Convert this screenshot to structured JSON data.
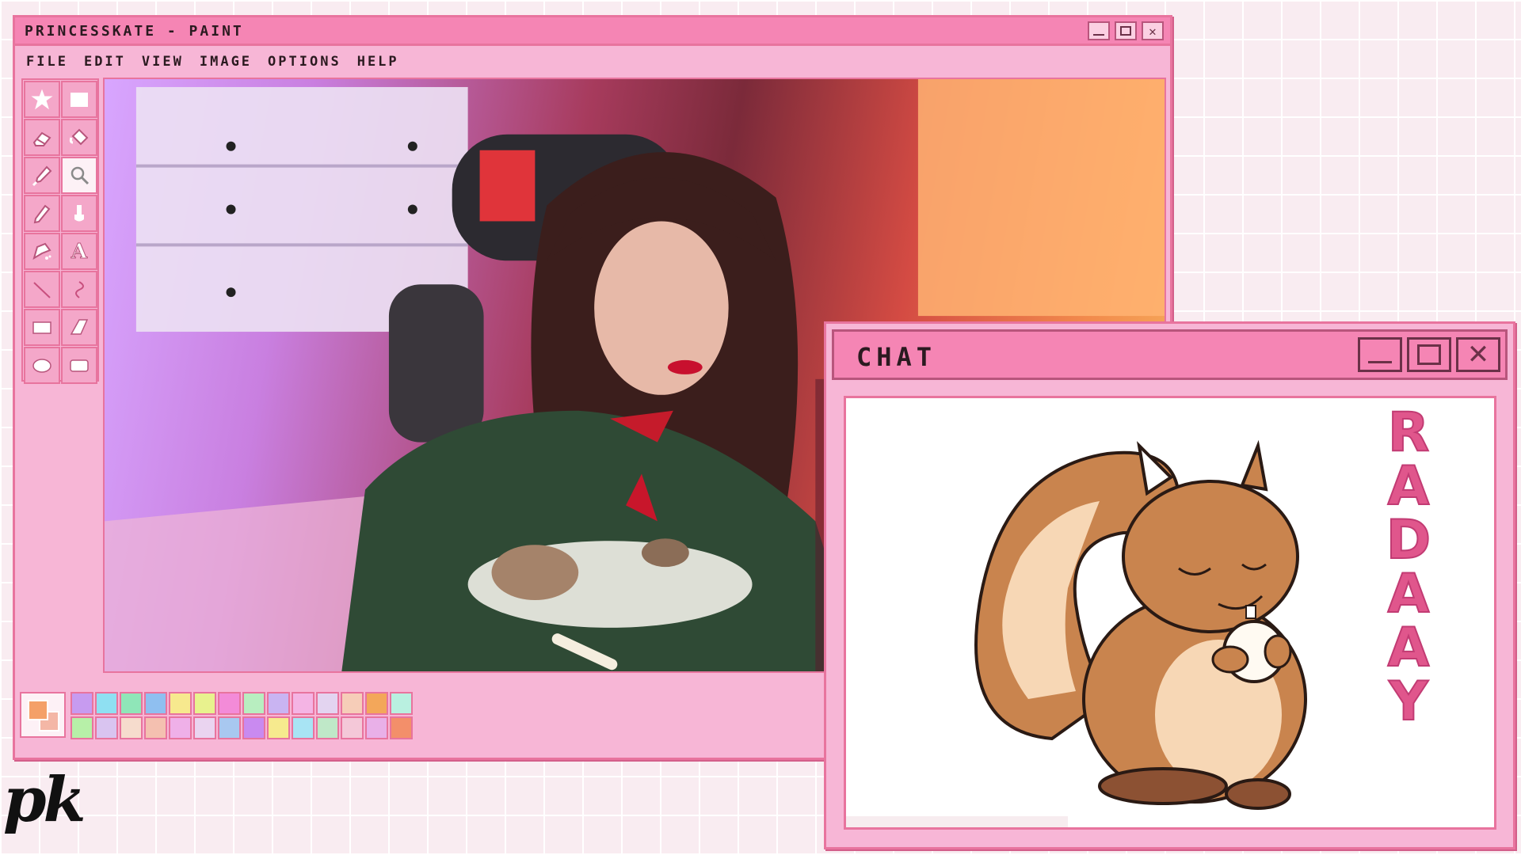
{
  "paint_window": {
    "title": "PRINCESSKATE - PAINT",
    "menu": [
      "FILE",
      "EDIT",
      "VIEW",
      "IMAGE",
      "OPTIONS",
      "HELP"
    ],
    "tools": [
      {
        "name": "free-select-icon"
      },
      {
        "name": "rect-select-icon"
      },
      {
        "name": "eraser-icon"
      },
      {
        "name": "fill-bucket-icon"
      },
      {
        "name": "color-picker-icon"
      },
      {
        "name": "magnifier-icon",
        "active": true
      },
      {
        "name": "pencil-icon"
      },
      {
        "name": "brush-icon"
      },
      {
        "name": "airbrush-icon"
      },
      {
        "name": "text-icon"
      },
      {
        "name": "line-icon"
      },
      {
        "name": "curve-icon"
      },
      {
        "name": "rectangle-icon"
      },
      {
        "name": "polygon-icon"
      },
      {
        "name": "ellipse-icon"
      },
      {
        "name": "rounded-rect-icon"
      }
    ],
    "text_tool_glyph": "A",
    "primary_color": "#f4a068",
    "secondary_color": "#f4b7a6",
    "palette": [
      "#c79bf0",
      "#8fe0f2",
      "#8fe6b8",
      "#8fbff0",
      "#f7e98e",
      "#e8f28e",
      "#f38bd8",
      "#b8eec0",
      "#c9b4f2",
      "#f4b4e4",
      "#e3d4f0",
      "#f6cdb8",
      "#f3a75a",
      "#b9f0e0",
      "#b7f0a8",
      "#d9c4f0",
      "#f6dccd",
      "#f4c0b0",
      "#efb0e8",
      "#ead4f0",
      "#a8c8f0",
      "#c98af0",
      "#f6ea8e",
      "#a8e4f4",
      "#bfe8c8",
      "#f4c8d8",
      "#e9b0e8",
      "#f38f6a"
    ]
  },
  "chat_window": {
    "title": "CHAT",
    "emote_text": [
      "R",
      "A",
      "D",
      "A",
      "A",
      "Y"
    ]
  },
  "overlay": {
    "signature": "pk"
  },
  "colors": {
    "window_pink": "#f7b6d6",
    "titlebar_pink": "#f585b4",
    "border_pink": "#e8749e"
  }
}
